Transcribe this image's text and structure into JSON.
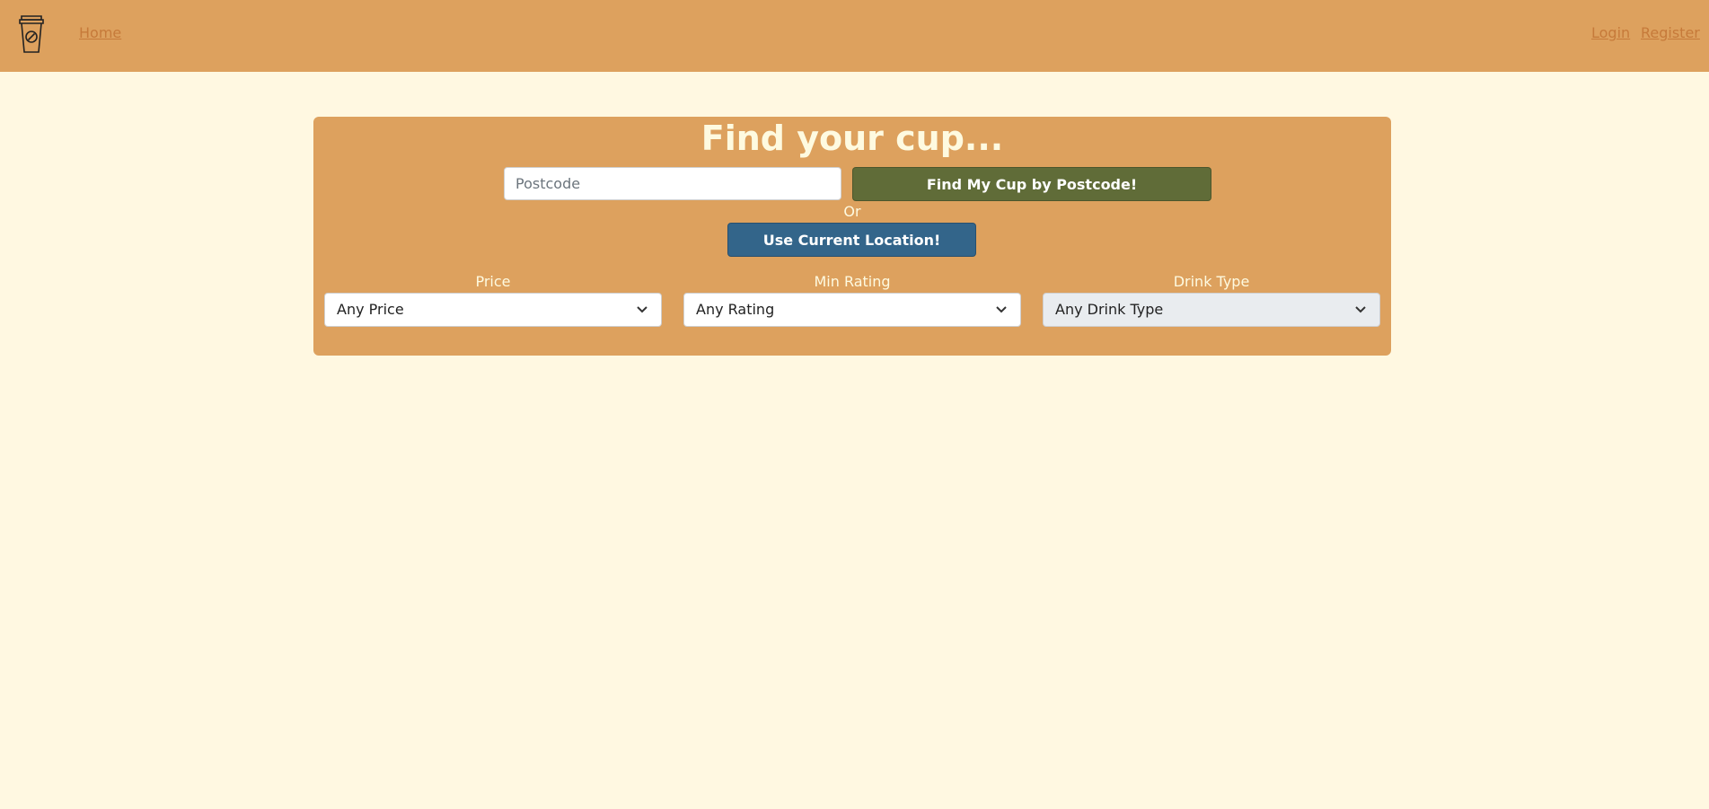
{
  "nav": {
    "home": "Home",
    "login": "Login",
    "register": "Register"
  },
  "search": {
    "title": "Find your cup...",
    "postcode_placeholder": "Postcode",
    "postcode_value": "",
    "postcode_button": "Find My Cup by Postcode!",
    "or_text": "Or",
    "location_button": "Use Current Location!"
  },
  "filters": [
    {
      "label": "Price",
      "selected": "Any Price"
    },
    {
      "label": "Min Rating",
      "selected": "Any Rating"
    },
    {
      "label": "Drink Type",
      "selected": "Any Drink Type"
    }
  ],
  "icons": {
    "logo": "coffee-cup-icon",
    "dropdown": "chevron-down-icon"
  },
  "colors": {
    "background": "#fff8e1",
    "navbar": "#dda15e",
    "panel": "#dda15e",
    "postcode_button": "#606c38",
    "location_button": "#33658a",
    "link": "#c67a3a"
  }
}
